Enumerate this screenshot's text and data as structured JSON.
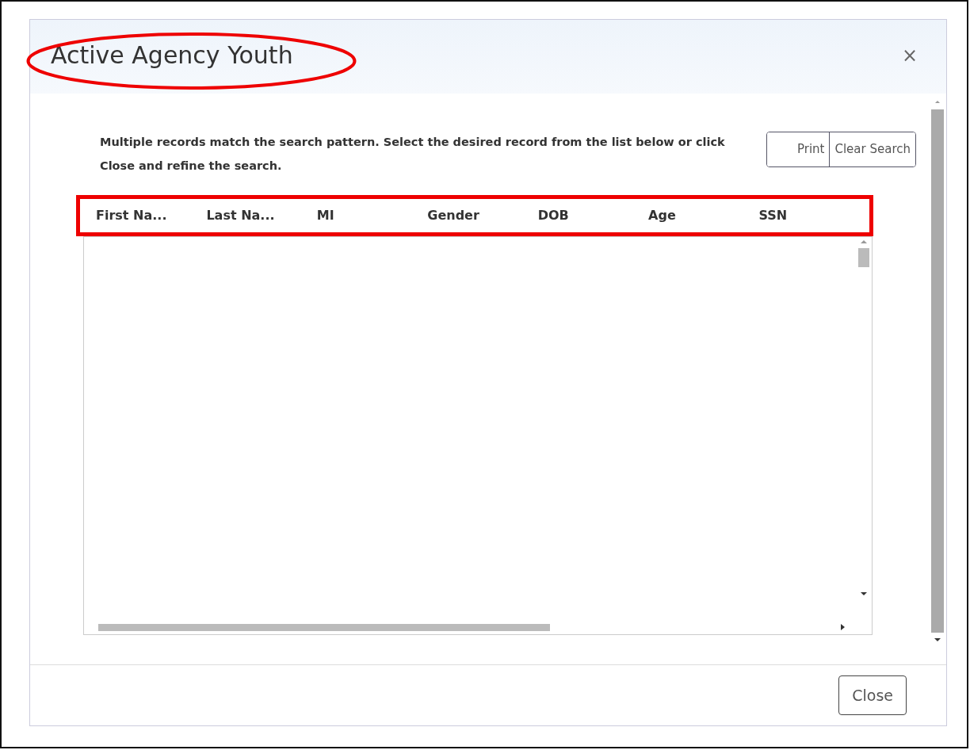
{
  "dialog": {
    "title": "Active Agency Youth",
    "title_circled": true,
    "close_glyph": "×"
  },
  "message": "Multiple records match the search pattern. Select the desired record from the list below or click Close and refine the search.",
  "toolbar": [
    "Print",
    "Clear Search"
  ],
  "grid": {
    "highlighted": true,
    "columns": [
      "First Na...",
      "Last Na...",
      "MI",
      "Gender",
      "DOB",
      "Age",
      "SSN"
    ]
  },
  "footer": {
    "close_button": "Close"
  }
}
